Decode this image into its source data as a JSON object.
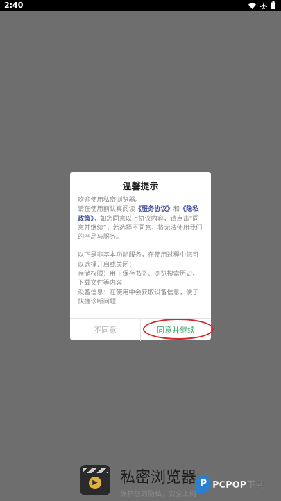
{
  "status_bar": {
    "time": "2:40",
    "icons": [
      "wifi-icon",
      "airplane-icon",
      "battery-icon"
    ]
  },
  "dialog": {
    "title": "温馨提示",
    "line1": "欢迎使用私密浏览器。",
    "line2_prefix": "请在使用前认真阅读",
    "service_link": "《服务协议》",
    "and": "和",
    "privacy_link": "《隐私政策》",
    "line2_suffix": "，如您同意以上协议内容，请点击“同意并继续”，若选择不同意，将无法使用我们的产品与服务。",
    "section2_intro": "以下是非基本功能服务，在使用过程中您可以选择开启或关闭：",
    "storage": "存储权限：用于保存书签、浏览搜索历史、下载文件等内容",
    "device": "设备信息：在使用中会获取设备信息，便于快捷诊断问题",
    "decline_label": "不同意",
    "accept_label": "同意并继续"
  },
  "brand": {
    "name": "私密浏览器",
    "tagline": "保护您的隐私，安全上网"
  },
  "watermark": {
    "icon_letter": "P",
    "text": "PCPOP下载"
  },
  "colors": {
    "accept": "#3aa36a",
    "link": "#3a4a9a",
    "highlight": "#d8262b"
  }
}
